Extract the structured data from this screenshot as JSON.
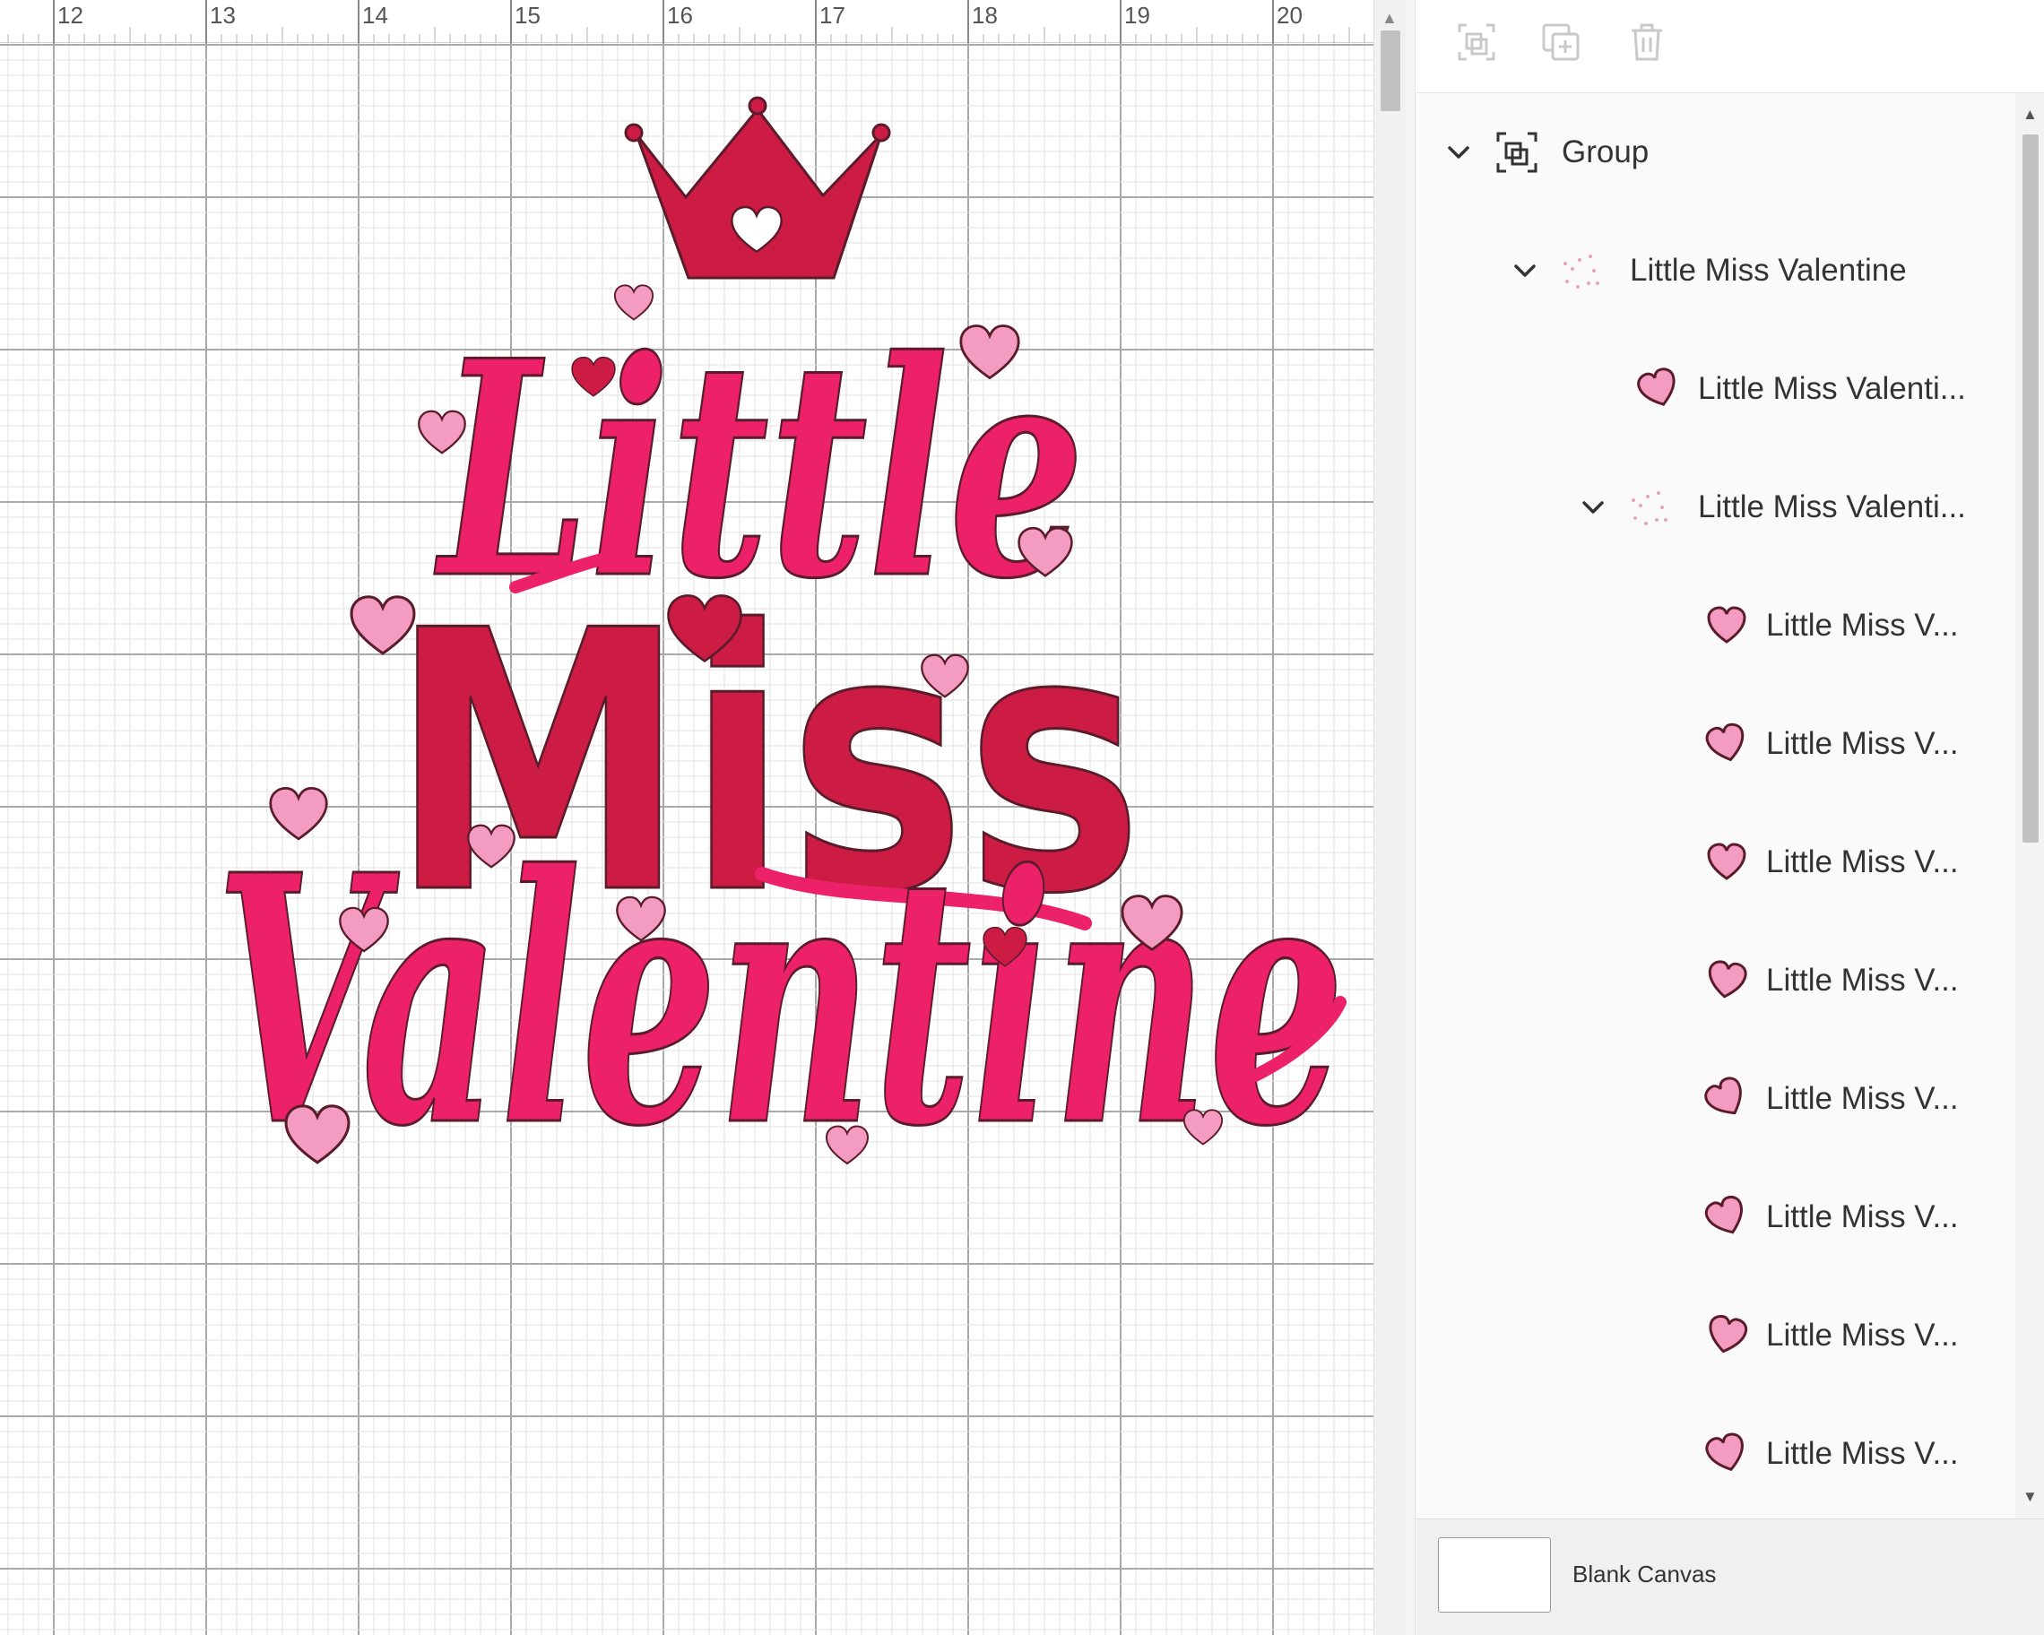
{
  "ruler": {
    "labels": [
      "12",
      "13",
      "14",
      "15",
      "16",
      "17",
      "18",
      "19",
      "20"
    ]
  },
  "design": {
    "word_1": "Little",
    "word_2": "Miss",
    "word_3": "Valentine",
    "colors": {
      "script_pink": "#ec2169",
      "miss_red": "#cc1c44",
      "light_heart": "#f49bc2",
      "outline": "#5a1b2a"
    }
  },
  "toolbar": {
    "icons": [
      "group-icon",
      "duplicate-icon",
      "delete-icon"
    ]
  },
  "layers": {
    "items": [
      {
        "label": "Group",
        "icon": "group-icon",
        "chevron": "chevron-down-icon"
      },
      {
        "label": "Little Miss Valentine",
        "icon": "layer-group-thumbnail-icon",
        "chevron": "chevron-down-icon"
      },
      {
        "label": "Little Miss Valenti...",
        "icon": "heart-icon"
      },
      {
        "label": "Little Miss Valenti...",
        "icon": "layer-group-thumbnail-icon",
        "chevron": "chevron-down-icon"
      },
      {
        "label": "Little Miss V...",
        "icon": "heart-icon"
      },
      {
        "label": "Little Miss V...",
        "icon": "heart-icon"
      },
      {
        "label": "Little Miss V...",
        "icon": "heart-icon"
      },
      {
        "label": "Little Miss V...",
        "icon": "heart-icon"
      },
      {
        "label": "Little Miss V...",
        "icon": "heart-icon"
      },
      {
        "label": "Little Miss V...",
        "icon": "heart-icon"
      },
      {
        "label": "Little Miss V...",
        "icon": "heart-icon"
      },
      {
        "label": "Little Miss V...",
        "icon": "heart-icon"
      }
    ]
  },
  "footer": {
    "canvas_label": "Blank Canvas"
  }
}
